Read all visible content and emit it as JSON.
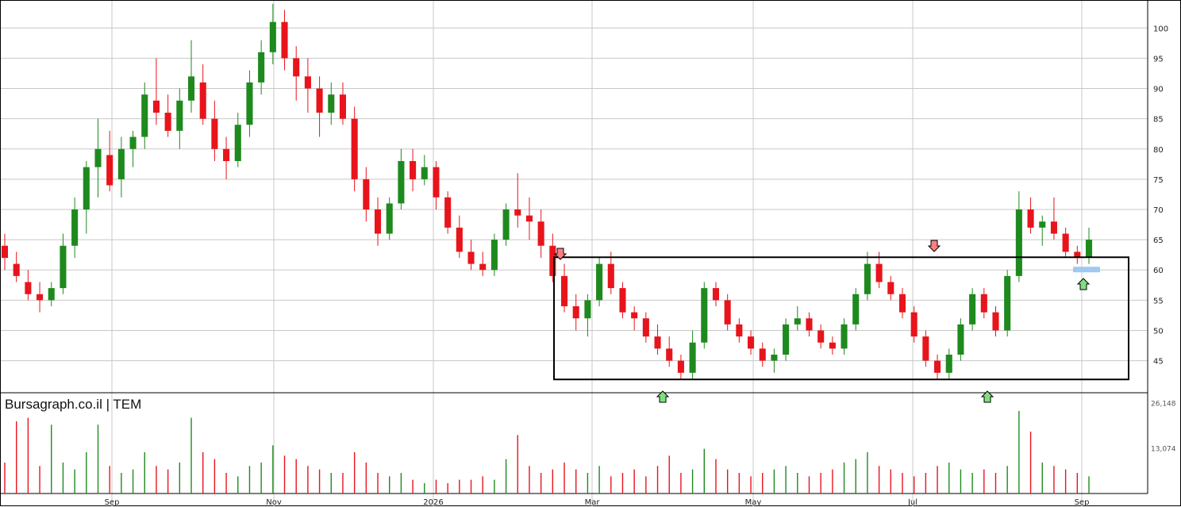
{
  "watermark": "Bursagraph.co.il | TEM",
  "colors": {
    "up": "#1e8a1e",
    "down": "#e8141c",
    "grid": "#c8c8c8",
    "frame": "#000000",
    "arrow_down": "#ff7f7f",
    "arrow_up": "#7fe07f",
    "band": "#9fc9ef"
  },
  "chart_data": {
    "type": "candlestick",
    "price_axis": {
      "ticks": [
        45,
        50,
        55,
        60,
        65,
        70,
        75,
        80,
        85,
        90,
        95,
        100
      ],
      "range": [
        39.7,
        104.5
      ],
      "position": "right"
    },
    "volume_axis": {
      "tick_labels": [
        "26,148",
        "13,074"
      ],
      "tick_values": [
        26148,
        13074
      ]
    },
    "x_axis": {
      "labels": [
        "Sep",
        "Nov",
        "2026",
        "Mar",
        "May",
        "Jul",
        "Sep"
      ]
    },
    "grid": true,
    "candles_ohlc_sample": [
      [
        64,
        66,
        60,
        62
      ],
      [
        61,
        63,
        58,
        59
      ],
      [
        58,
        60,
        55,
        56
      ],
      [
        56,
        58,
        53,
        55
      ],
      [
        55,
        58,
        54,
        57
      ],
      [
        57,
        66,
        56,
        64
      ],
      [
        64,
        72,
        62,
        70
      ],
      [
        70,
        78,
        66,
        77
      ],
      [
        77,
        85,
        72,
        80
      ],
      [
        79,
        83,
        73,
        74
      ],
      [
        75,
        82,
        72,
        80
      ],
      [
        80,
        83,
        77,
        82
      ],
      [
        82,
        91,
        80,
        89
      ],
      [
        88,
        95,
        84,
        86
      ],
      [
        86,
        89,
        82,
        83
      ],
      [
        83,
        90,
        80,
        88
      ],
      [
        88,
        98,
        86,
        92
      ],
      [
        91,
        94,
        84,
        85
      ],
      [
        85,
        88,
        78,
        80
      ],
      [
        80,
        82,
        75,
        78
      ],
      [
        78,
        86,
        77,
        84
      ],
      [
        84,
        93,
        82,
        91
      ],
      [
        91,
        98,
        89,
        96
      ],
      [
        96,
        104,
        94,
        101
      ],
      [
        101,
        103,
        93,
        95
      ],
      [
        95,
        97,
        88,
        92
      ],
      [
        92,
        95,
        86,
        90
      ],
      [
        90,
        92,
        82,
        86
      ],
      [
        86,
        91,
        84,
        89
      ],
      [
        89,
        91,
        84,
        85
      ],
      [
        85,
        87,
        73,
        75
      ],
      [
        75,
        77,
        68,
        70
      ],
      [
        70,
        72,
        64,
        66
      ],
      [
        66,
        72,
        65,
        71
      ],
      [
        71,
        80,
        70,
        78
      ],
      [
        78,
        80,
        73,
        75
      ],
      [
        75,
        79,
        74,
        77
      ],
      [
        77,
        78,
        70,
        72
      ],
      [
        72,
        73,
        66,
        67
      ],
      [
        67,
        69,
        62,
        63
      ],
      [
        63,
        65,
        60,
        61
      ],
      [
        61,
        63,
        59,
        60
      ],
      [
        60,
        66,
        59,
        65
      ],
      [
        65,
        71,
        64,
        70
      ],
      [
        70,
        76,
        67,
        69
      ],
      [
        69,
        72,
        65,
        68
      ],
      [
        68,
        70,
        62,
        64
      ],
      [
        64,
        66,
        58,
        59
      ],
      [
        59,
        61,
        53,
        54
      ],
      [
        54,
        56,
        50,
        52
      ],
      [
        52,
        56,
        49,
        55
      ],
      [
        55,
        62,
        54,
        61
      ],
      [
        61,
        63,
        56,
        57
      ],
      [
        57,
        58,
        52,
        53
      ],
      [
        53,
        54,
        50,
        52
      ],
      [
        52,
        53,
        48,
        49
      ],
      [
        49,
        51,
        46,
        47
      ],
      [
        47,
        49,
        44,
        45
      ],
      [
        45,
        46,
        42,
        43
      ],
      [
        43,
        50,
        42,
        48
      ],
      [
        48,
        58,
        47,
        57
      ],
      [
        57,
        58,
        54,
        55
      ],
      [
        55,
        56,
        50,
        51
      ],
      [
        51,
        52,
        48,
        49
      ],
      [
        49,
        50,
        46,
        47
      ],
      [
        47,
        48,
        44,
        45
      ],
      [
        45,
        47,
        43,
        46
      ],
      [
        46,
        52,
        45,
        51
      ],
      [
        51,
        54,
        50,
        52
      ],
      [
        52,
        53,
        49,
        50
      ],
      [
        50,
        51,
        47,
        48
      ],
      [
        48,
        49,
        46,
        47
      ],
      [
        47,
        52,
        46,
        51
      ],
      [
        51,
        57,
        50,
        56
      ],
      [
        56,
        63,
        55,
        61
      ],
      [
        61,
        63,
        57,
        58
      ],
      [
        58,
        59,
        55,
        56
      ],
      [
        56,
        57,
        52,
        53
      ],
      [
        53,
        54,
        48,
        49
      ],
      [
        49,
        50,
        44,
        45
      ],
      [
        45,
        46,
        42,
        43
      ],
      [
        43,
        47,
        42,
        46
      ],
      [
        46,
        52,
        45,
        51
      ],
      [
        51,
        57,
        50,
        56
      ],
      [
        56,
        57,
        52,
        53
      ],
      [
        53,
        54,
        49,
        50
      ],
      [
        50,
        60,
        49,
        59
      ],
      [
        59,
        73,
        58,
        70
      ],
      [
        70,
        72,
        66,
        67
      ],
      [
        67,
        69,
        64,
        68
      ],
      [
        68,
        72,
        65,
        66
      ],
      [
        66,
        67,
        62,
        63
      ],
      [
        63,
        64,
        61,
        62
      ],
      [
        62,
        67,
        61,
        65
      ]
    ],
    "volume_sample": [
      9000,
      21000,
      22000,
      8000,
      20000,
      9000,
      7000,
      12000,
      20000,
      8000,
      6000,
      7000,
      12000,
      8000,
      7000,
      9000,
      22000,
      12000,
      10000,
      6000,
      5000,
      8000,
      9000,
      14000,
      11000,
      10000,
      8000,
      7000,
      6000,
      6000,
      12000,
      9000,
      6000,
      5000,
      6000,
      4000,
      3000,
      4000,
      3000,
      4000,
      4000,
      5000,
      4000,
      10000,
      17000,
      8000,
      6000,
      7000,
      9000,
      7000,
      6000,
      8000,
      5000,
      6000,
      7000,
      5000,
      8000,
      11000,
      6000,
      7000,
      13000,
      10000,
      7000,
      6000,
      5000,
      6000,
      7000,
      8000,
      6000,
      5000,
      6000,
      7000,
      9000,
      10000,
      12000,
      8000,
      7000,
      6000,
      5000,
      6000,
      8000,
      9000,
      7000,
      6000,
      7000,
      6000,
      8000,
      24000,
      18000,
      9000,
      8000,
      7000,
      6000,
      5000
    ],
    "annotations": {
      "rectangle": {
        "price_range": [
          41.9,
          62.1
        ]
      },
      "down_arrows": [
        "Mar",
        "Jul"
      ],
      "up_arrows": [
        "Mar-Apr",
        "Jul-Aug",
        "Sep"
      ],
      "support_band_price": 60
    }
  }
}
